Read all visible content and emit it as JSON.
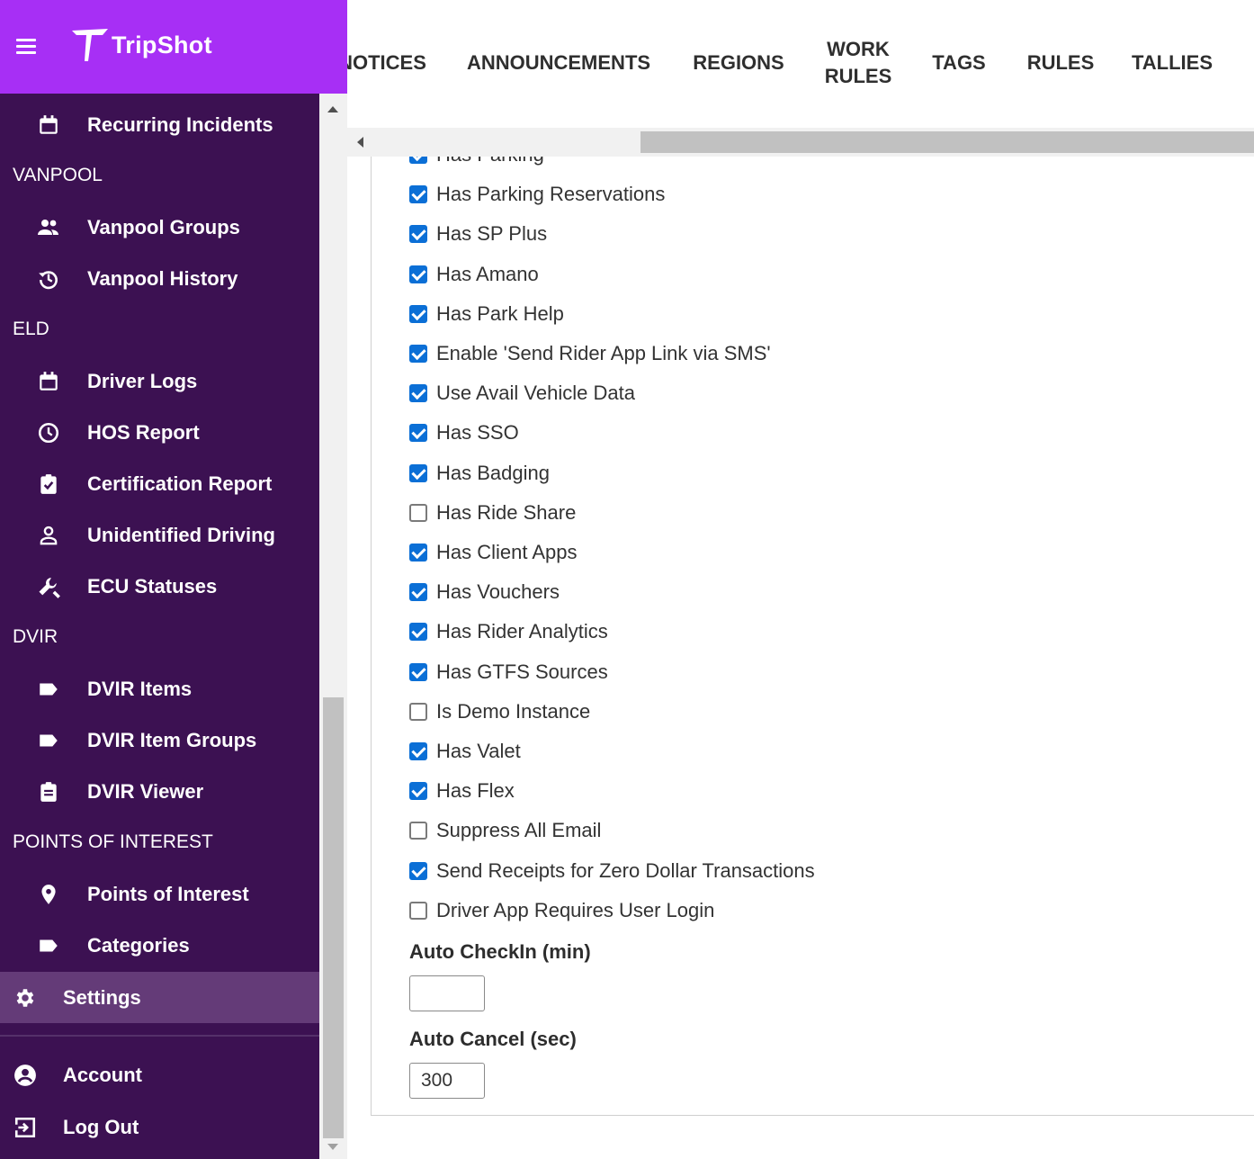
{
  "brand": {
    "name": "TripShot",
    "color": "#a72ff5",
    "sidebar_color": "#3c1152"
  },
  "sidebar": {
    "items": [
      {
        "type": "item",
        "label": "Recurring Incidents",
        "icon": "calendar-icon"
      },
      {
        "type": "section",
        "label": "VANPOOL"
      },
      {
        "type": "item",
        "label": "Vanpool Groups",
        "icon": "people-icon"
      },
      {
        "type": "item",
        "label": "Vanpool History",
        "icon": "history-icon"
      },
      {
        "type": "section",
        "label": "ELD"
      },
      {
        "type": "item",
        "label": "Driver Logs",
        "icon": "calendar-icon"
      },
      {
        "type": "item",
        "label": "HOS Report",
        "icon": "clock-icon"
      },
      {
        "type": "item",
        "label": "Certification Report",
        "icon": "clipboard-check-icon"
      },
      {
        "type": "item",
        "label": "Unidentified Driving",
        "icon": "person-icon"
      },
      {
        "type": "item",
        "label": "ECU Statuses",
        "icon": "wrench-icon"
      },
      {
        "type": "section",
        "label": "DVIR"
      },
      {
        "type": "item",
        "label": "DVIR Items",
        "icon": "label-icon"
      },
      {
        "type": "item",
        "label": "DVIR Item Groups",
        "icon": "label-icon"
      },
      {
        "type": "item",
        "label": "DVIR Viewer",
        "icon": "clipboard-icon"
      },
      {
        "type": "section",
        "label": "POINTS OF INTEREST"
      },
      {
        "type": "item",
        "label": "Points of Interest",
        "icon": "location-pin-icon"
      },
      {
        "type": "item",
        "label": "Categories",
        "icon": "label-icon"
      }
    ],
    "settings": {
      "label": "Settings",
      "icon": "gear-icon",
      "active": true
    },
    "account": {
      "label": "Account",
      "icon": "account-circle-icon"
    },
    "logout": {
      "label": "Log Out",
      "icon": "logout-icon"
    }
  },
  "tabs": [
    {
      "label": "NOTICES"
    },
    {
      "label": "ANNOUNCEMENTS"
    },
    {
      "label": "REGIONS"
    },
    {
      "label": "WORK\nRULES"
    },
    {
      "label": "TAGS"
    },
    {
      "label": "RULES"
    },
    {
      "label": "TALLIES"
    }
  ],
  "settings": {
    "checkboxes": [
      {
        "label": "Has Parking",
        "checked": true
      },
      {
        "label": "Has Parking Reservations",
        "checked": true
      },
      {
        "label": "Has SP Plus",
        "checked": true
      },
      {
        "label": "Has Amano",
        "checked": true
      },
      {
        "label": "Has Park Help",
        "checked": true
      },
      {
        "label": "Enable 'Send Rider App Link via SMS'",
        "checked": true
      },
      {
        "label": "Use Avail Vehicle Data",
        "checked": true
      },
      {
        "label": "Has SSO",
        "checked": true
      },
      {
        "label": "Has Badging",
        "checked": true
      },
      {
        "label": "Has Ride Share",
        "checked": false
      },
      {
        "label": "Has Client Apps",
        "checked": true
      },
      {
        "label": "Has Vouchers",
        "checked": true
      },
      {
        "label": "Has Rider Analytics",
        "checked": true
      },
      {
        "label": "Has GTFS Sources",
        "checked": true
      },
      {
        "label": "Is Demo Instance",
        "checked": false
      },
      {
        "label": "Has Valet",
        "checked": true
      },
      {
        "label": "Has Flex",
        "checked": true
      },
      {
        "label": "Suppress All Email",
        "checked": false
      },
      {
        "label": "Send Receipts for Zero Dollar Transactions",
        "checked": true
      },
      {
        "label": "Driver App Requires User Login",
        "checked": false
      }
    ],
    "auto_checkin": {
      "label": "Auto CheckIn (min)",
      "value": ""
    },
    "auto_cancel": {
      "label": "Auto Cancel (sec)",
      "value": "300"
    }
  }
}
